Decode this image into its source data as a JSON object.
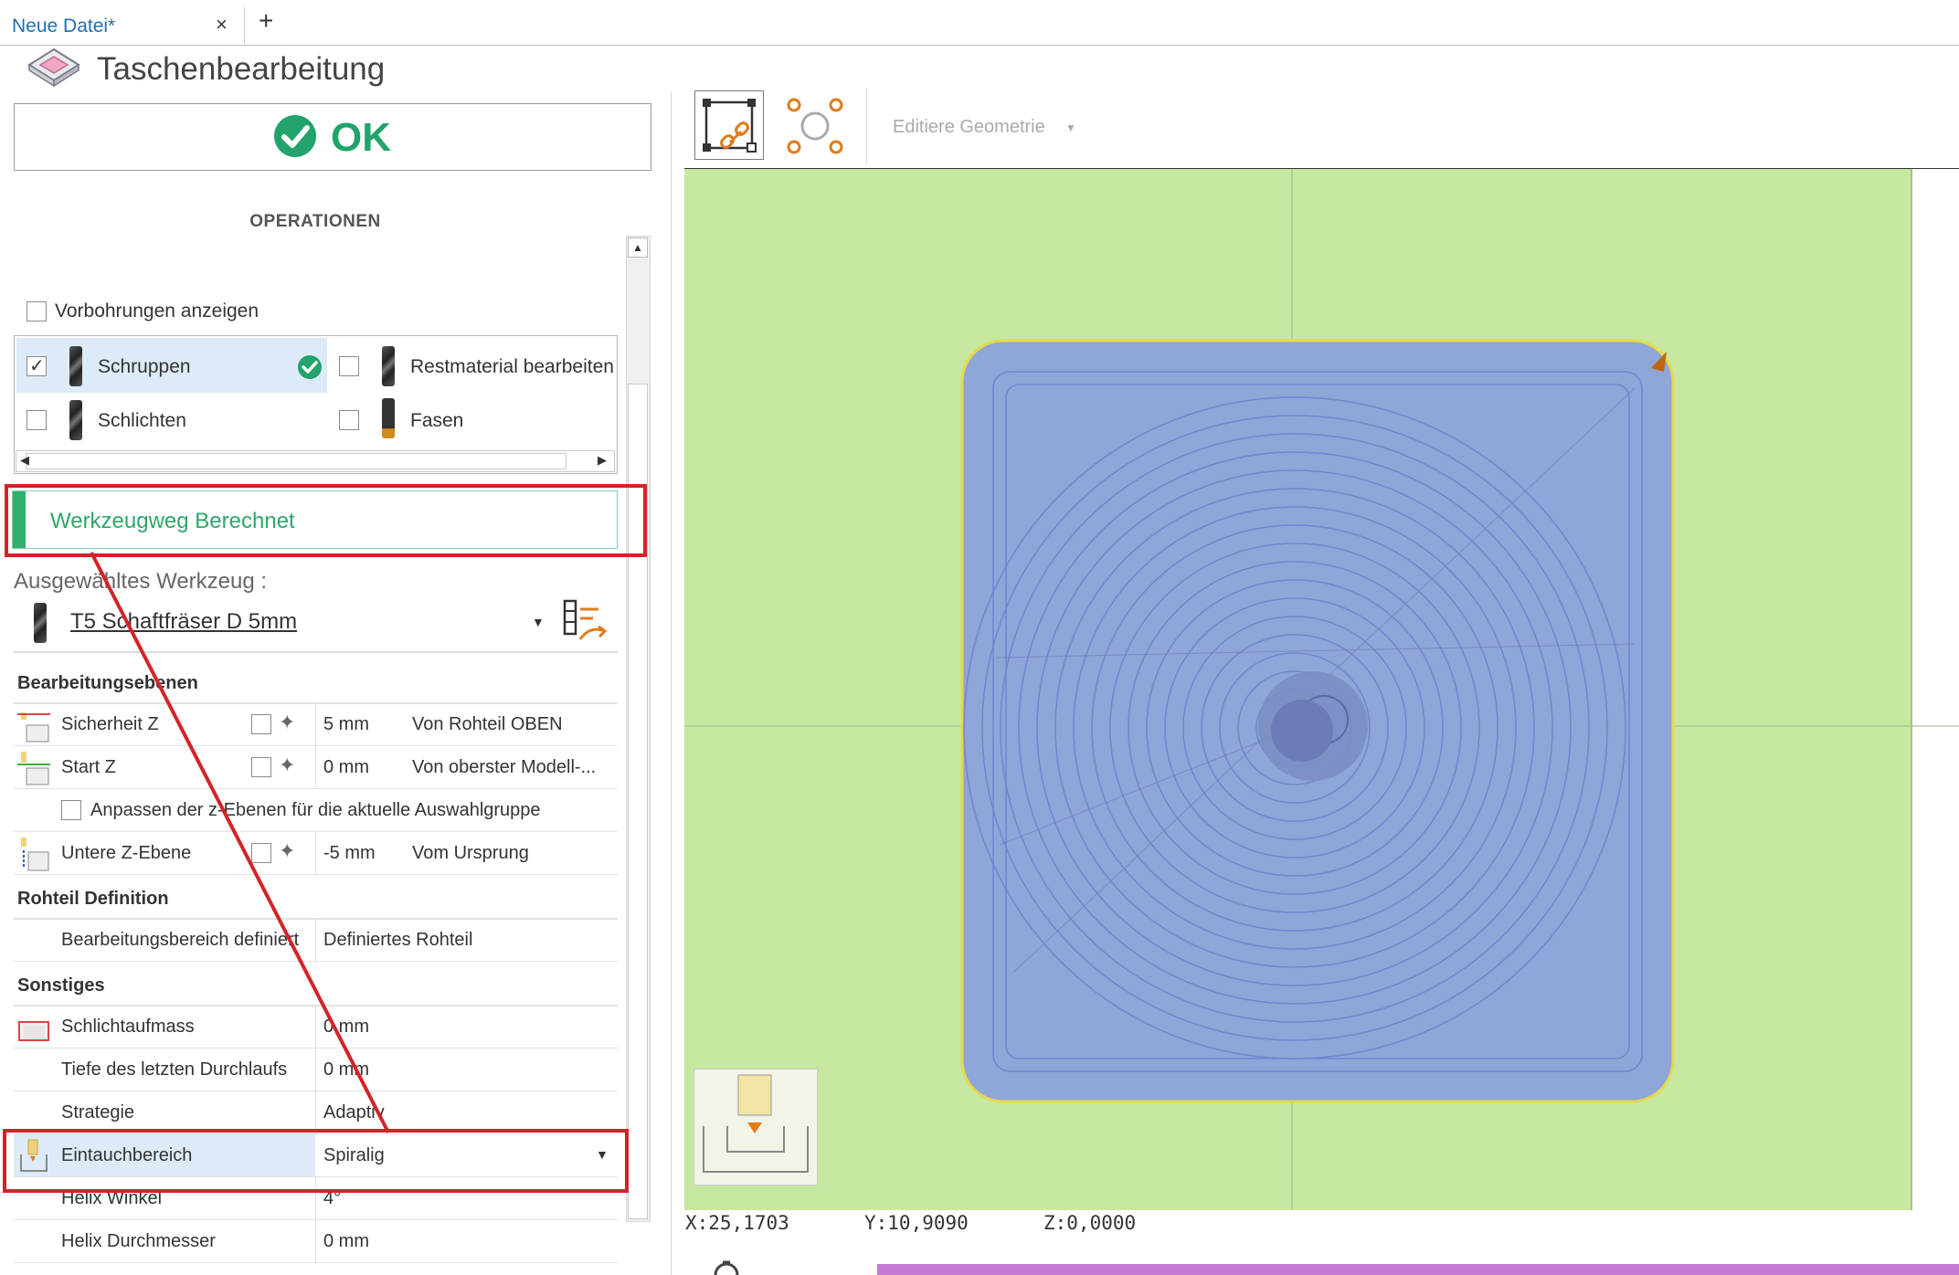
{
  "tabs": {
    "active_label": "Neue Datei*",
    "close_symbol": "×",
    "add_symbol": "+"
  },
  "panel": {
    "title": "Taschenbearbeitung",
    "ok_label": "OK",
    "operations_heading": "OPERATIONEN",
    "show_predrill_label": "Vorbohrungen anzeigen",
    "operations": [
      {
        "label": "Schruppen",
        "checked": true,
        "done": true
      },
      {
        "label": "Restmaterial bearbeiten",
        "checked": false
      },
      {
        "label": "Schlichten",
        "checked": false
      },
      {
        "label": "Fasen",
        "checked": false
      }
    ],
    "status_text": "Werkzeugweg Berechnet",
    "selected_tool_heading": "Ausgewähltes Werkzeug :",
    "selected_tool_name": "T5 Schaftfräser D 5mm",
    "sections": {
      "levels": "Bearbeitungsebenen",
      "stock": "Rohteil Definition",
      "misc": "Sonstiges"
    },
    "rows": {
      "safety_z": {
        "label": "Sicherheit Z",
        "value": "5 mm",
        "ref": "Von Rohteil OBEN"
      },
      "start_z": {
        "label": "Start Z",
        "value": "0 mm",
        "ref": "Von oberster Modell-..."
      },
      "adjust_z": {
        "label": "Anpassen der z-Ebenen für die aktuelle Auswahlgruppe"
      },
      "lower_z": {
        "label": "Untere Z-Ebene",
        "value": "-5 mm",
        "ref": "Vom Ursprung"
      },
      "area": {
        "label": "Bearbeitungsbereich definiert",
        "value": "Definiertes Rohteil"
      },
      "finish_allow": {
        "label": "Schlichtaufmass",
        "value": "0 mm"
      },
      "last_depth": {
        "label": "Tiefe des letzten Durchlaufs",
        "value": "0 mm"
      },
      "strategy": {
        "label": "Strategie",
        "value": "Adaptiv"
      },
      "plunge": {
        "label": "Eintauchbereich",
        "value": "Spiralig"
      },
      "helix_angle": {
        "label": "Helix Winkel",
        "value": "4°"
      },
      "helix_diam": {
        "label": "Helix Durchmesser",
        "value": "0 mm"
      }
    }
  },
  "viewport": {
    "toolbar_label": "Editiere Geometrie",
    "coord_x": "X:25,1703",
    "coord_y": "Y:10,9090",
    "coord_z": "Z:0,0000"
  },
  "colors": {
    "accent_green": "#21a36b",
    "highlight_red": "#d42328",
    "stock_green": "#c6e8a0",
    "pocket_blue": "#8ea6d8",
    "toolpath_blue": "#6f86cc",
    "progress": "#c47ad6",
    "selection_blue": "#dcebf7"
  }
}
